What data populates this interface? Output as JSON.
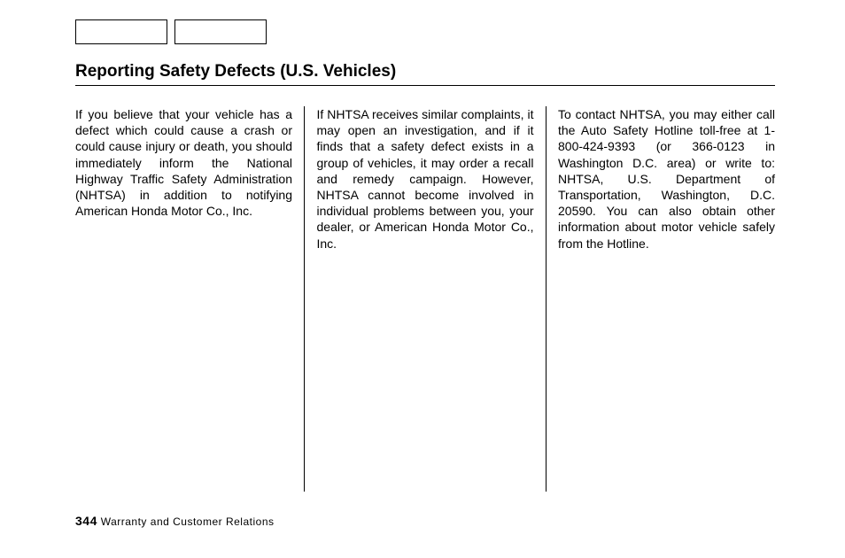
{
  "title": "Reporting Safety Defects (U.S. Vehicles)",
  "columns": {
    "c1": "If you believe that your vehicle has a defect which could cause a crash or could cause injury or death, you should immediately inform the National Highway Traffic Safety Administration (NHTSA) in addition to notifying American Honda Motor Co., Inc.",
    "c2": "If NHTSA receives similar com­plaints, it may open an investigation, and if it finds that a safety defect exists in a group of vehicles, it may order a recall and remedy campaign. However, NHTSA cannot become involved in individual problems between you, your dealer, or American Honda Motor Co., Inc.",
    "c3": "To contact NHTSA, you may either call the Auto Safety Hotline toll-free at 1-800-424-9393 (or 366-0123 in Washington D.C. area) or write to: NHTSA, U.S. Department of Transportation, Washington, D.C. 20590. You can also obtain other information about motor vehicle safely from the Hotline."
  },
  "footer": {
    "page": "344",
    "section": "Warranty and Customer Relations"
  }
}
